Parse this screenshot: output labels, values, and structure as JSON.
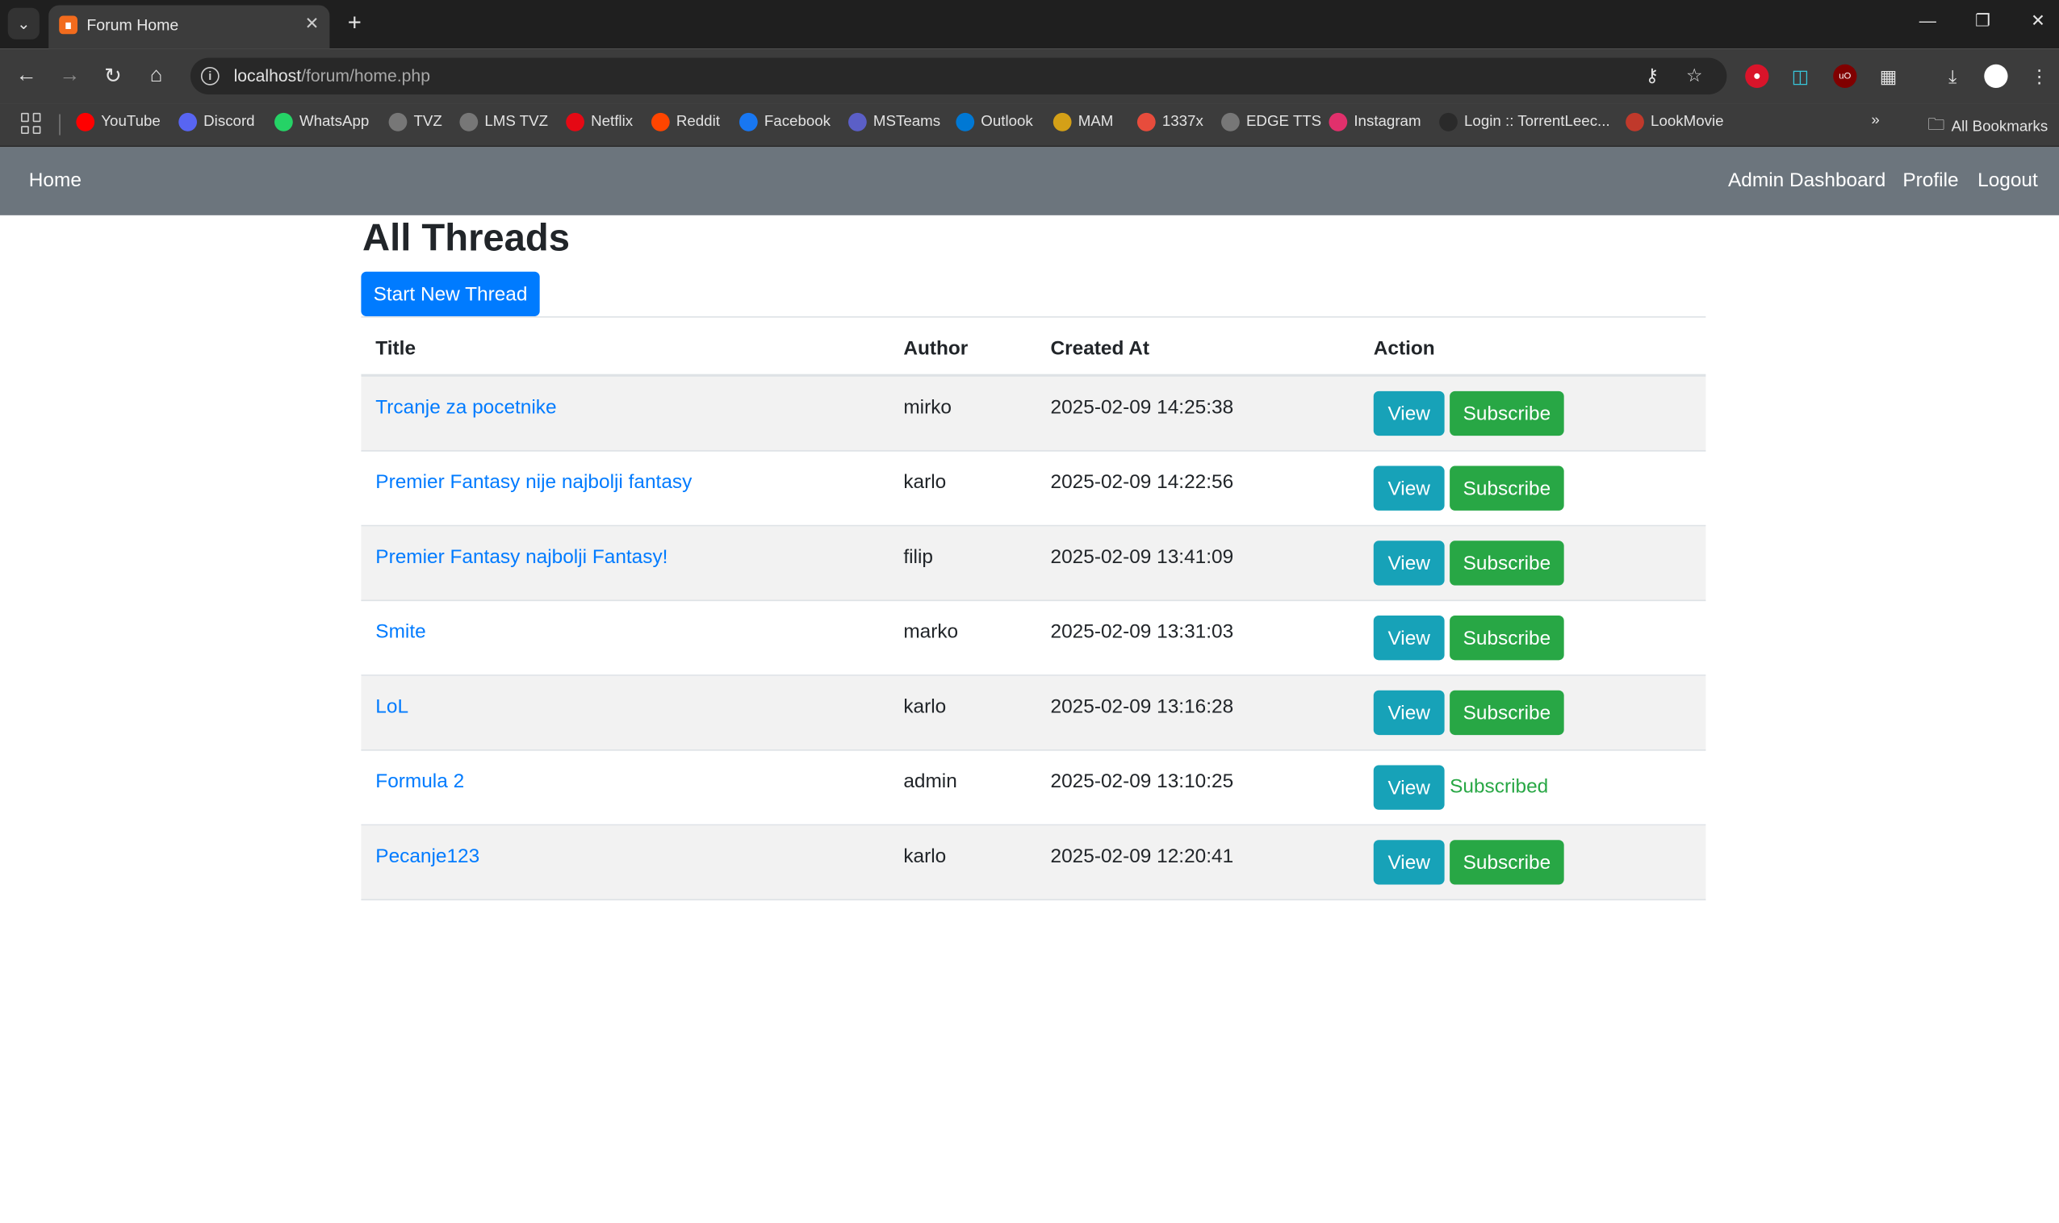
{
  "browser": {
    "tab_title": "Forum Home",
    "url_host": "localhost",
    "url_path": "/forum/home.php",
    "bookmarks": [
      {
        "label": "YouTube",
        "icon": "youtube-icon",
        "color": "#ff0000"
      },
      {
        "label": "Discord",
        "icon": "discord-icon",
        "color": "#5865f2"
      },
      {
        "label": "WhatsApp",
        "icon": "whatsapp-icon",
        "color": "#25d366"
      },
      {
        "label": "TVZ",
        "icon": "globe-icon",
        "color": "#777777"
      },
      {
        "label": "LMS TVZ",
        "icon": "globe-icon",
        "color": "#777777"
      },
      {
        "label": "Netflix",
        "icon": "netflix-icon",
        "color": "#e50914"
      },
      {
        "label": "Reddit",
        "icon": "reddit-icon",
        "color": "#ff4500"
      },
      {
        "label": "Facebook",
        "icon": "facebook-icon",
        "color": "#1877f2"
      },
      {
        "label": "MSTeams",
        "icon": "teams-icon",
        "color": "#5b5fc7"
      },
      {
        "label": "Outlook",
        "icon": "outlook-icon",
        "color": "#0078d4"
      },
      {
        "label": "MAM",
        "icon": "mam-icon",
        "color": "#d4a017"
      },
      {
        "label": "1337x",
        "icon": "x-icon",
        "color": "#e74c3c"
      },
      {
        "label": "EDGE TTS",
        "icon": "globe-icon",
        "color": "#777777"
      },
      {
        "label": "Instagram",
        "icon": "instagram-icon",
        "color": "#e1306c"
      },
      {
        "label": "Login :: TorrentLeec...",
        "icon": "torrentleech-icon",
        "color": "#2a2a2a"
      },
      {
        "label": "LookMovie",
        "icon": "lookmovie-icon",
        "color": "#c0392b"
      }
    ],
    "all_bookmarks": "All Bookmarks"
  },
  "navbar": {
    "home": "Home",
    "admin_dashboard": "Admin Dashboard",
    "profile": "Profile",
    "logout": "Logout"
  },
  "page": {
    "title": "All Threads",
    "new_thread_button": "Start New Thread"
  },
  "table": {
    "headers": [
      "Title",
      "Author",
      "Created At",
      "Action"
    ],
    "view_label": "View",
    "subscribe_label": "Subscribe",
    "subscribed_label": "Subscribed",
    "rows": [
      {
        "title": "Trcanje za pocetnike",
        "author": "mirko",
        "created_at": "2025-02-09 14:25:38",
        "subscribed": false
      },
      {
        "title": "Premier Fantasy nije najbolji fantasy",
        "author": "karlo",
        "created_at": "2025-02-09 14:22:56",
        "subscribed": false
      },
      {
        "title": "Premier Fantasy najbolji Fantasy!",
        "author": "filip",
        "created_at": "2025-02-09 13:41:09",
        "subscribed": false
      },
      {
        "title": "Smite",
        "author": "marko",
        "created_at": "2025-02-09 13:31:03",
        "subscribed": false
      },
      {
        "title": "LoL",
        "author": "karlo",
        "created_at": "2025-02-09 13:16:28",
        "subscribed": false
      },
      {
        "title": "Formula 2",
        "author": "admin",
        "created_at": "2025-02-09 13:10:25",
        "subscribed": true
      },
      {
        "title": "Pecanje123",
        "author": "karlo",
        "created_at": "2025-02-09 12:20:41",
        "subscribed": false
      }
    ]
  }
}
